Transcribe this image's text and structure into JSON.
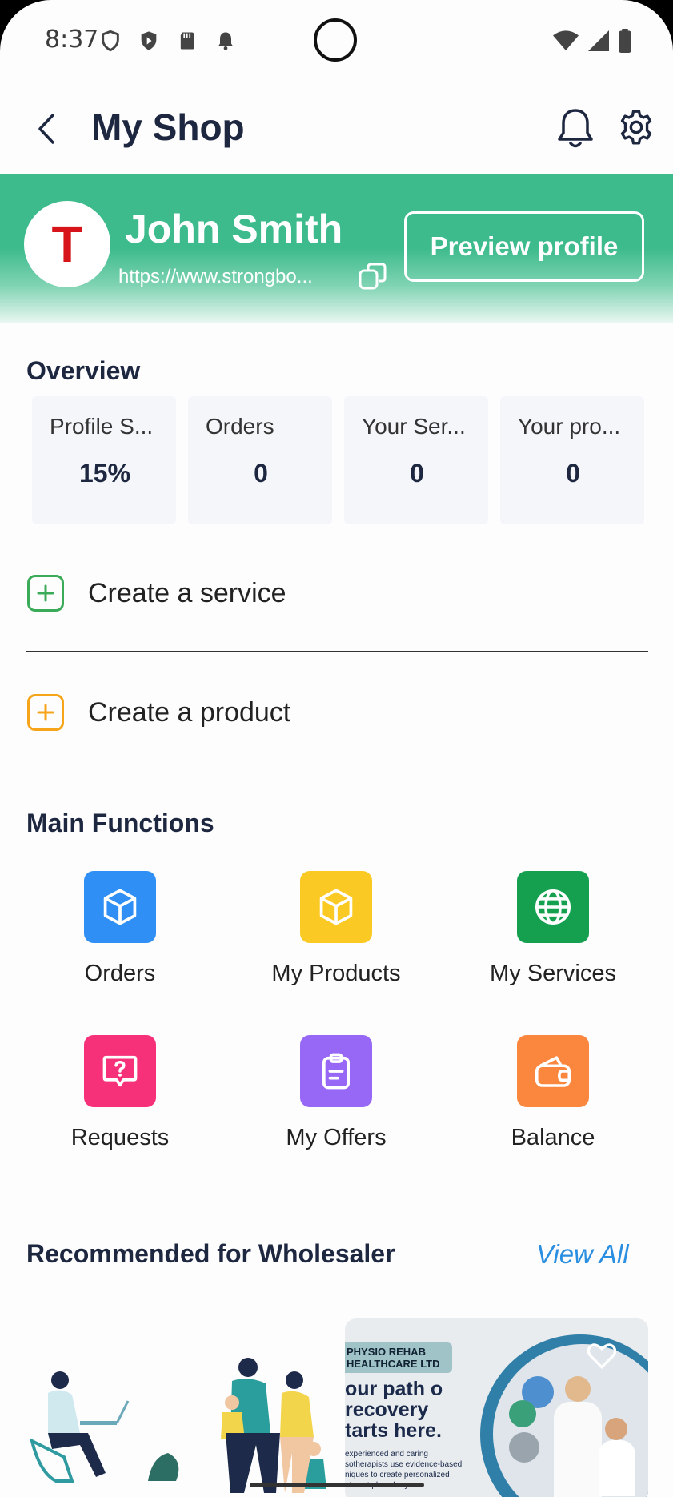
{
  "status_bar": {
    "time": "8:37"
  },
  "app_bar": {
    "title": "My Shop"
  },
  "profile": {
    "initial": "T",
    "name": "John Smith",
    "url": "https://www.strongbo...",
    "preview_label": "Preview profile"
  },
  "overview": {
    "title": "Overview",
    "cards": [
      {
        "label": "Profile S...",
        "value": "15%"
      },
      {
        "label": "Orders",
        "value": "0"
      },
      {
        "label": "Your Ser...",
        "value": "0"
      },
      {
        "label": "Your pro...",
        "value": "0"
      }
    ]
  },
  "actions": {
    "create_service": "Create a service",
    "create_product": "Create a product"
  },
  "main_functions": {
    "title": "Main Functions",
    "items": [
      {
        "label": "Orders",
        "icon": "box-icon",
        "color": "#2f8ff5"
      },
      {
        "label": "My Products",
        "icon": "box-icon",
        "color": "#fbc924"
      },
      {
        "label": "My Services",
        "icon": "globe-icon",
        "color": "#14a04f"
      },
      {
        "label": "Requests",
        "icon": "question-bubble-icon",
        "color": "#f6317a"
      },
      {
        "label": "My Offers",
        "icon": "clipboard-icon",
        "color": "#9768f6"
      },
      {
        "label": "Balance",
        "icon": "wallet-icon",
        "color": "#fb873f"
      }
    ]
  },
  "recommended": {
    "title": "Recommended for Wholesaler",
    "view_all": "View All",
    "banner": {
      "tag": "PHYSIO REHAB HEALTHCARE LTD",
      "headline": "our path o recovery tarts here.",
      "subtext": "experienced and caring sotherapists use evidence-based niques to create personalized atment plans for you."
    }
  },
  "colors": {
    "accent": "#3dbb8d",
    "title": "#1d2740",
    "link": "#2a8fe0"
  }
}
